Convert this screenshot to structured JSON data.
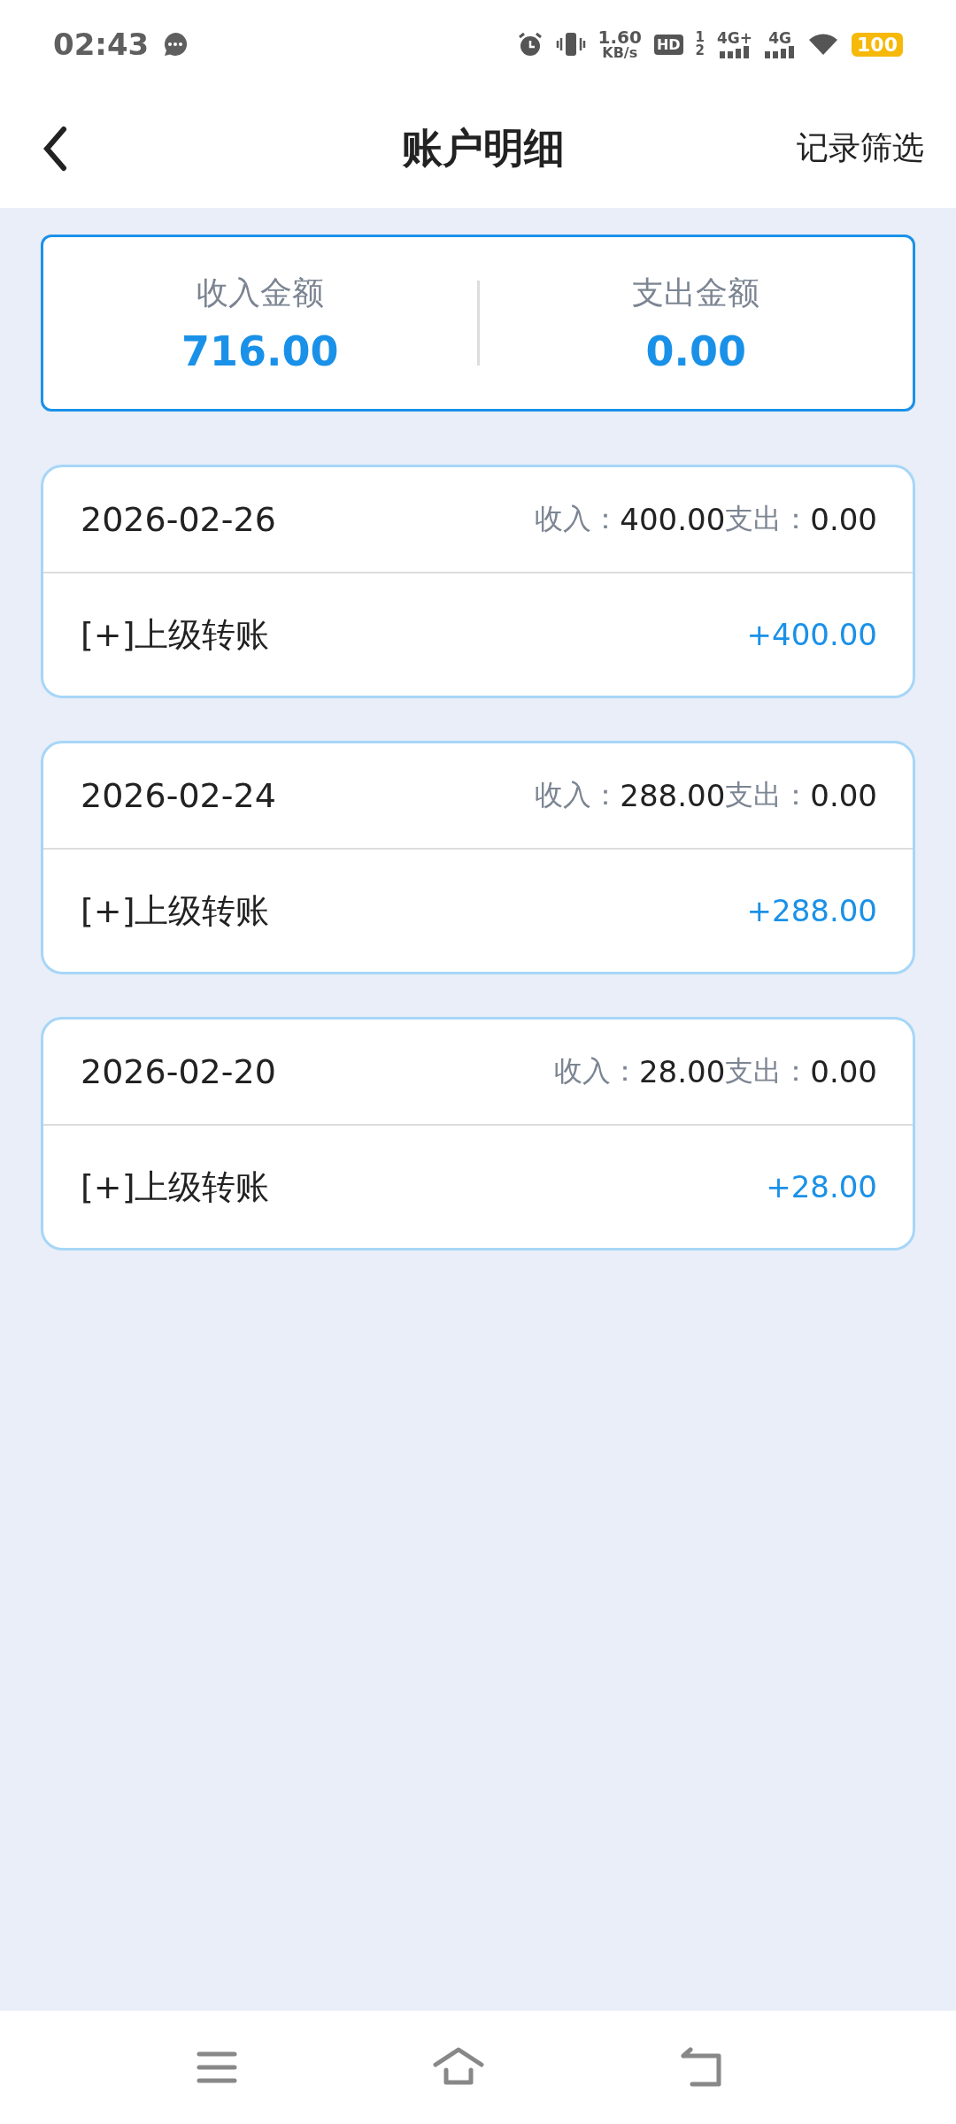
{
  "status_bar": {
    "time": "02:43",
    "speed_value": "1.60",
    "speed_unit": "KB/s",
    "hd": "HD",
    "hd_sup": "1",
    "hd_sub": "2",
    "network_1": "4G+",
    "network_2": "4G",
    "battery": "100"
  },
  "header": {
    "title": "账户明细",
    "action": "记录筛选"
  },
  "summary": [
    {
      "label": "收入金额",
      "value": "716.00"
    },
    {
      "label": "支出金额",
      "value": "0.00"
    }
  ],
  "records": [
    {
      "date": "2026-02-26",
      "income_label": "收入：",
      "income": "400.00",
      "expense_label": "支出：",
      "expense": "0.00",
      "entries": [
        {
          "title": "[+]上级转账",
          "amount": "+400.00"
        }
      ]
    },
    {
      "date": "2026-02-24",
      "income_label": "收入：",
      "income": "288.00",
      "expense_label": "支出：",
      "expense": "0.00",
      "entries": [
        {
          "title": "[+]上级转账",
          "amount": "+288.00"
        }
      ]
    },
    {
      "date": "2026-02-20",
      "income_label": "收入：",
      "income": "28.00",
      "expense_label": "支出：",
      "expense": "0.00",
      "entries": [
        {
          "title": "[+]上级转账",
          "amount": "+28.00"
        }
      ]
    }
  ]
}
